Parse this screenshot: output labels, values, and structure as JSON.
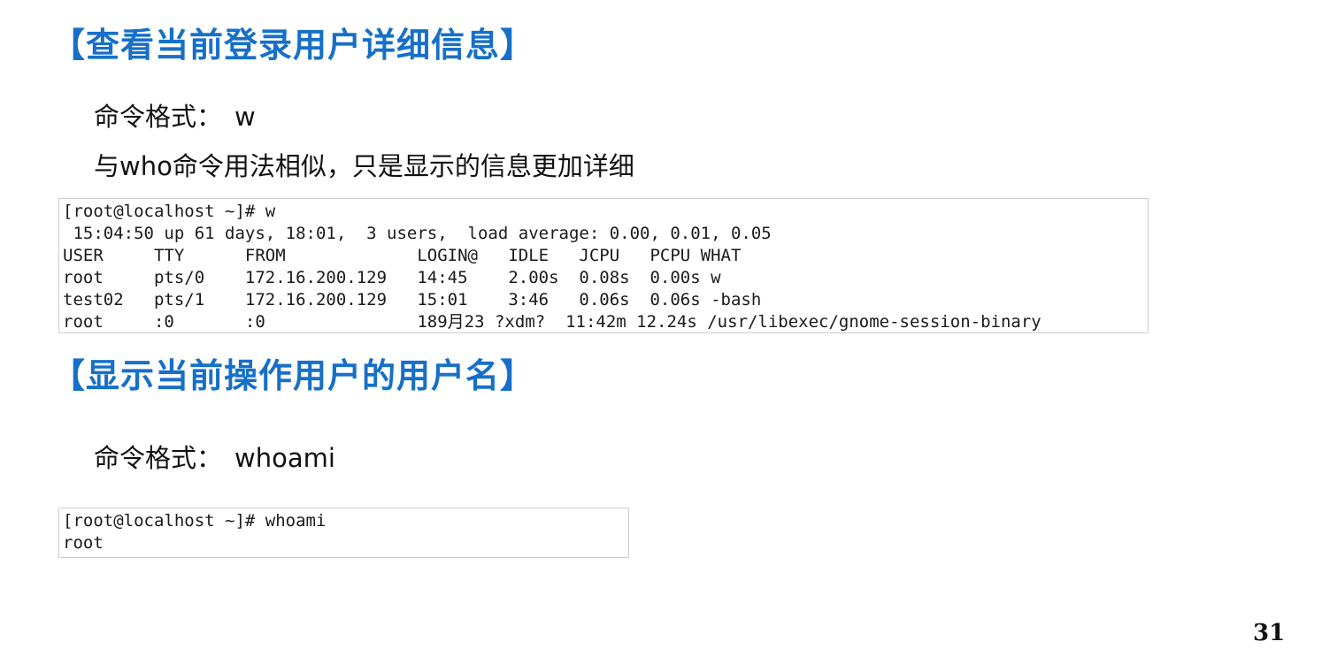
{
  "section1": {
    "heading": "【查看当前登录用户详细信息】",
    "format_label": "命令格式：",
    "format_command": "w",
    "description": "与who命令用法相似，只是显示的信息更加详细",
    "terminal_lines": [
      "[root@localhost ~]# w",
      " 15:04:50 up 61 days, 18:01,  3 users,  load average: 0.00, 0.01, 0.05",
      "USER     TTY      FROM             LOGIN@   IDLE   JCPU   PCPU WHAT",
      "root     pts/0    172.16.200.129   14:45    2.00s  0.08s  0.00s w",
      "test02   pts/1    172.16.200.129   15:01    3:46   0.06s  0.06s -bash",
      "root     :0       :0               189月23 ?xdm?  11:42m 12.24s /usr/libexec/gnome-session-binary"
    ]
  },
  "section2": {
    "heading": "【显示当前操作用户的用户名】",
    "format_label": "命令格式：",
    "format_command": "whoami",
    "terminal_lines": [
      "[root@localhost ~]# whoami",
      "root"
    ]
  },
  "page_number": "31"
}
